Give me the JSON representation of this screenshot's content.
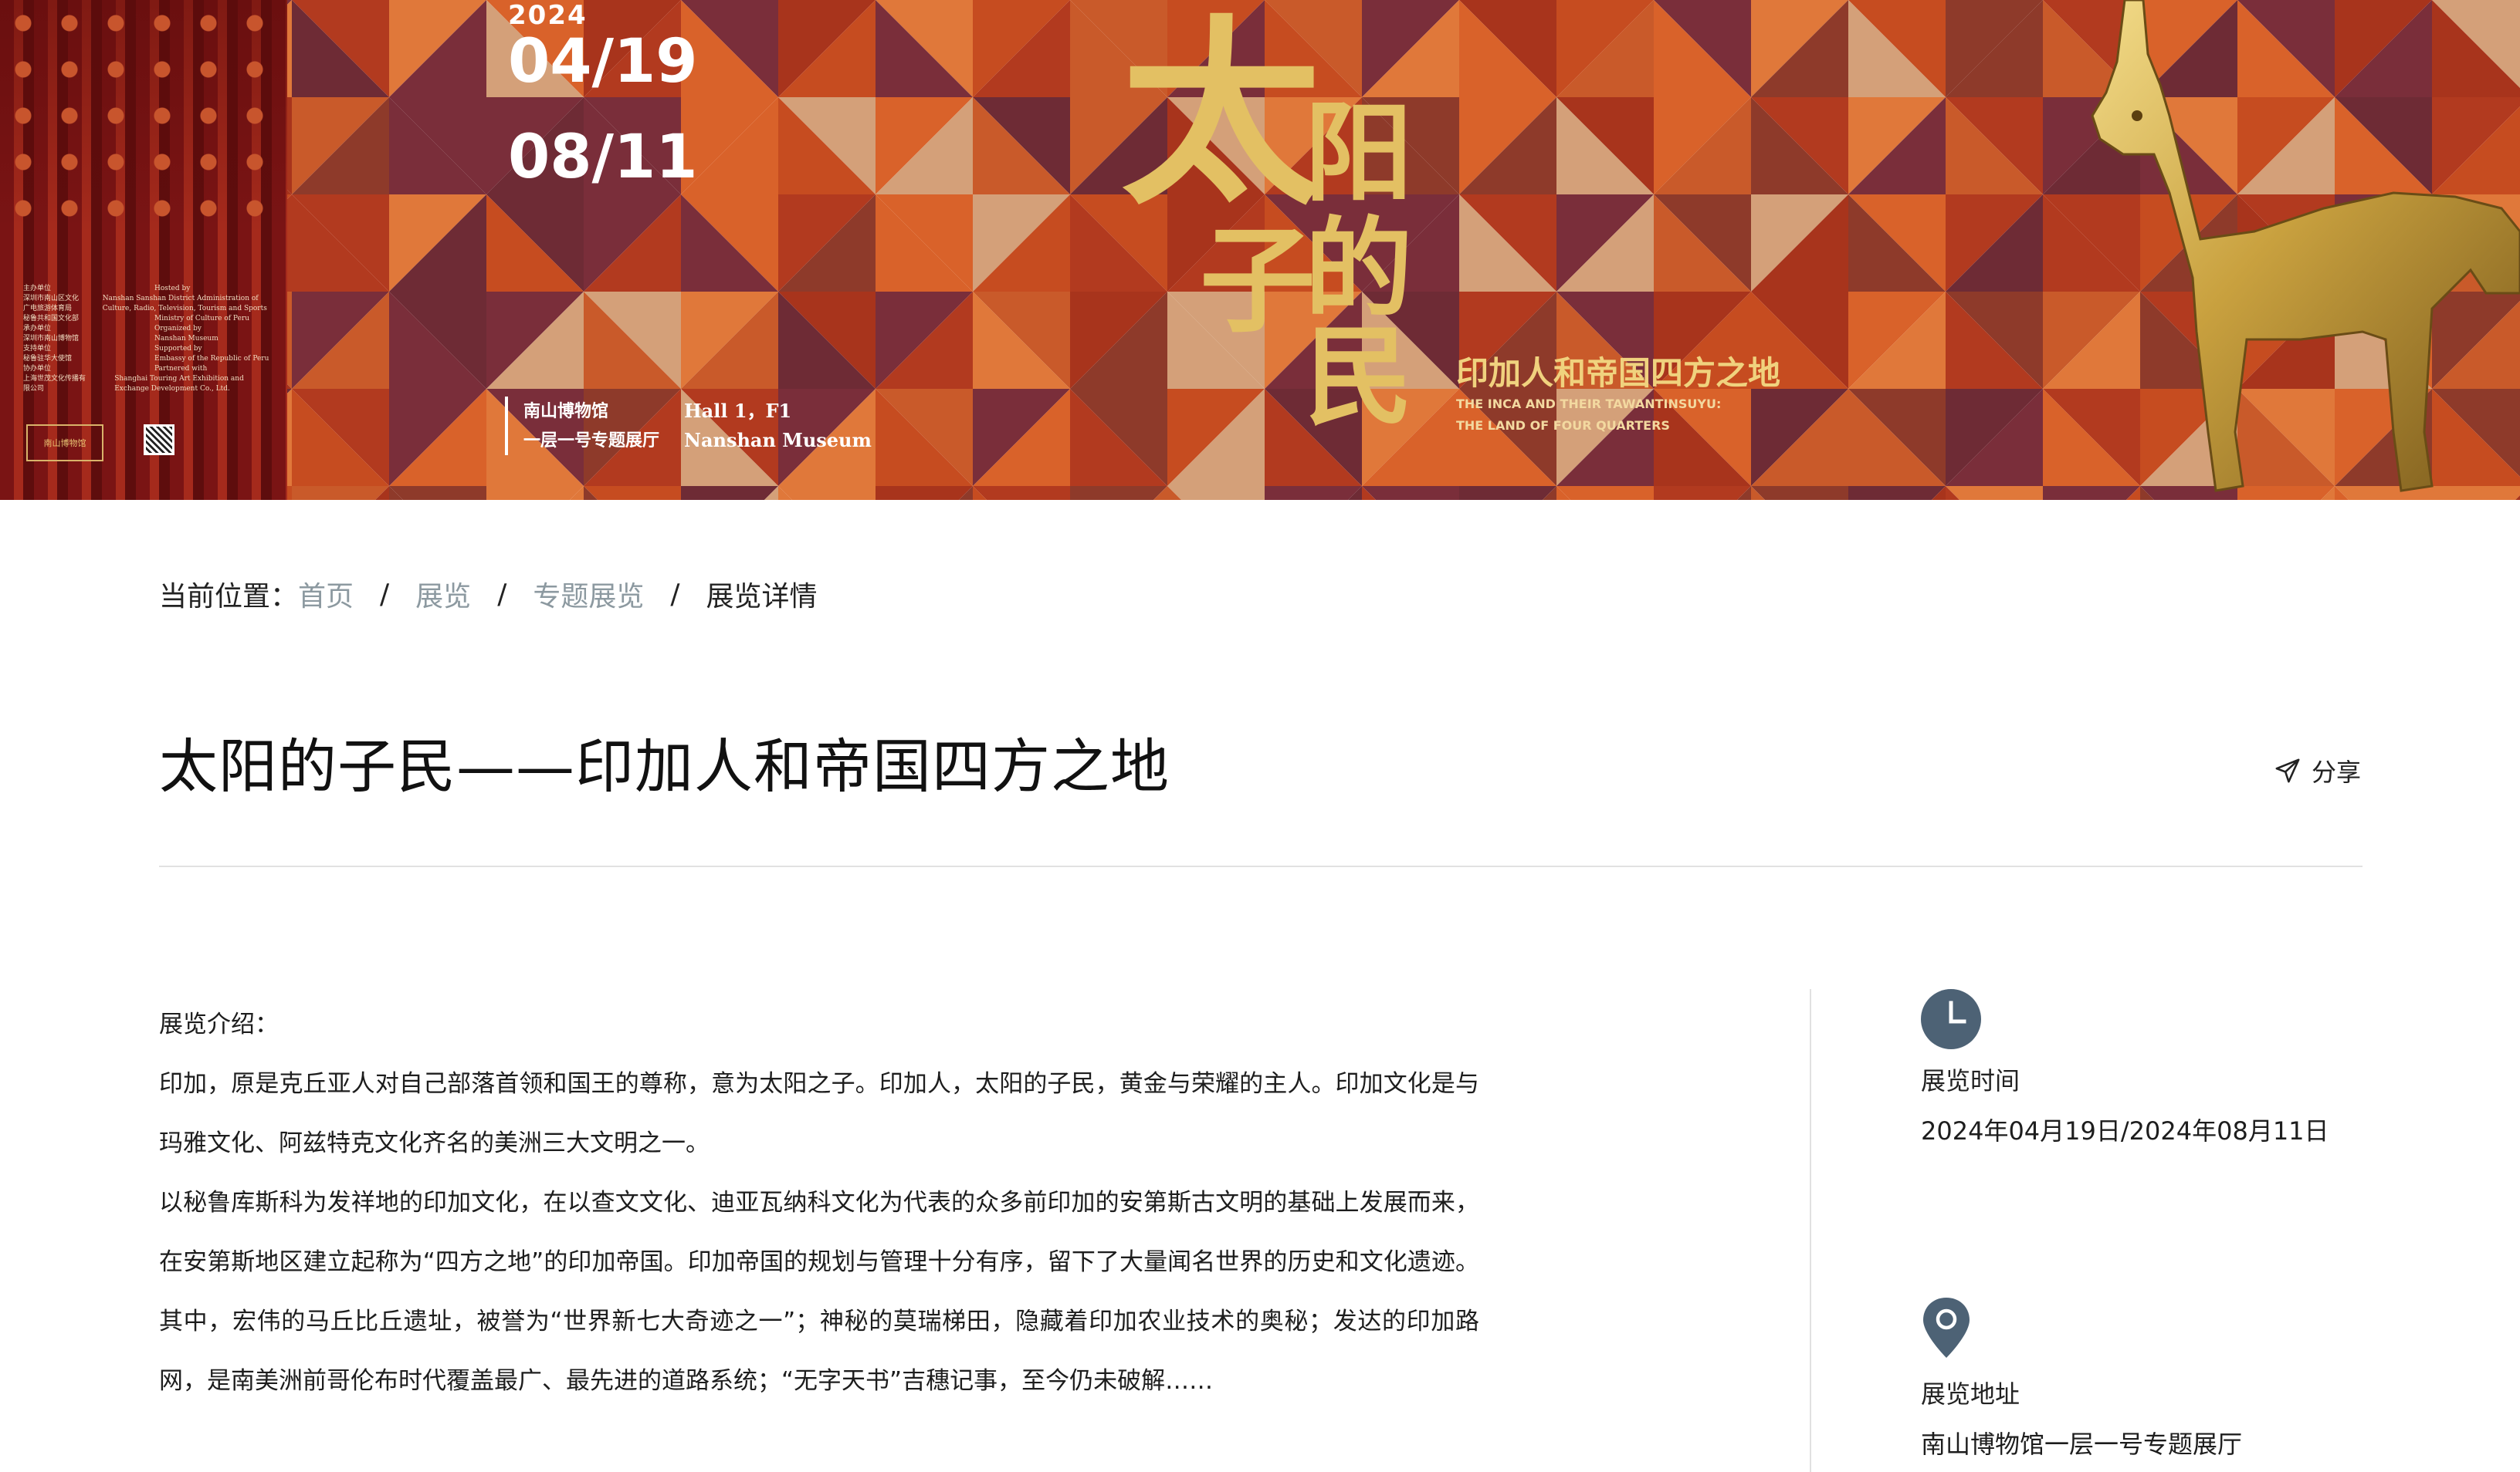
{
  "banner": {
    "poster_credits": [
      {
        "cn": "主办单位",
        "en": "Hosted by"
      },
      {
        "cn": "深圳市南山区文化广电旅游体育局",
        "en": "Nanshan Sanshan District Administration of Culture, Radio, Television, Tourism and Sports"
      },
      {
        "cn": "秘鲁共和国文化部",
        "en": "Ministry of Culture of Peru"
      },
      {
        "cn": "承办单位",
        "en": "Organized by"
      },
      {
        "cn": "深圳市南山博物馆",
        "en": "Nanshan Museum"
      },
      {
        "cn": "支持单位",
        "en": "Supported by"
      },
      {
        "cn": "秘鲁驻华大使馆",
        "en": "Embassy of the Republic of Peru"
      },
      {
        "cn": "协办单位",
        "en": "Partnered with"
      },
      {
        "cn": "上海世茂文化传播有限公司",
        "en": "Shanghai Touring Art Exhibition and Exchange Development Co., Ltd."
      }
    ],
    "poster_logo": "南山博物馆",
    "year": "2024",
    "start_date": "04/19",
    "end_date": "08/11",
    "venue_cn_line1": "南山博物馆",
    "venue_cn_line2": "一层一号专题展厅",
    "venue_en_line1": "Hall 1，F1",
    "venue_en_line2": "Nanshan Museum",
    "title_chars": [
      "太",
      "阳",
      "子",
      "的",
      "民"
    ],
    "subtitle_cn": "印加人和帝国四方之地",
    "subtitle_en_line1": "THE INCA AND THEIR TAWANTINSUYU:",
    "subtitle_en_line2": "THE LAND OF FOUR QUARTERS"
  },
  "breadcrumb": {
    "prefix": "当前位置：",
    "items": [
      "首页",
      "展览",
      "专题展览"
    ],
    "current": "展览详情",
    "separator": "/"
  },
  "page_title": "太阳的子民——印加人和帝国四方之地",
  "share_label": "分享",
  "intro": {
    "label": "展览介绍：",
    "paragraphs": [
      "印加，原是克丘亚人对自己部落首领和国王的尊称，意为太阳之子。印加人，太阳的子民，黄金与荣耀的主人。印加文化是与玛雅文化、阿兹特克文化齐名的美洲三大文明之一。",
      "以秘鲁库斯科为发祥地的印加文化，在以查文文化、迪亚瓦纳科文化为代表的众多前印加的安第斯古文明的基础上发展而来，在安第斯地区建立起称为“四方之地”的印加帝国。印加帝国的规划与管理十分有序，留下了大量闻名世界的历史和文化遗迹。其中，宏伟的马丘比丘遗址，被誉为“世界新七大奇迹之一”；神秘的莫瑞梯田，隐藏着印加农业技术的奥秘；发达的印加路网，是南美洲前哥伦布时代覆盖最广、最先进的道路系统；“无字天书”吉穗记事，至今仍未破解……"
    ]
  },
  "sidebar": {
    "time_label": "展览时间",
    "time_value": "2024年04月19日/2024年08月11日",
    "address_label": "展览地址",
    "address_value": "南山博物馆一层一号专题展厅"
  },
  "colors": {
    "accent_icon": "#4d6275",
    "banner_gold": "#e3c063",
    "breadcrumb_link": "#8c99a0"
  }
}
